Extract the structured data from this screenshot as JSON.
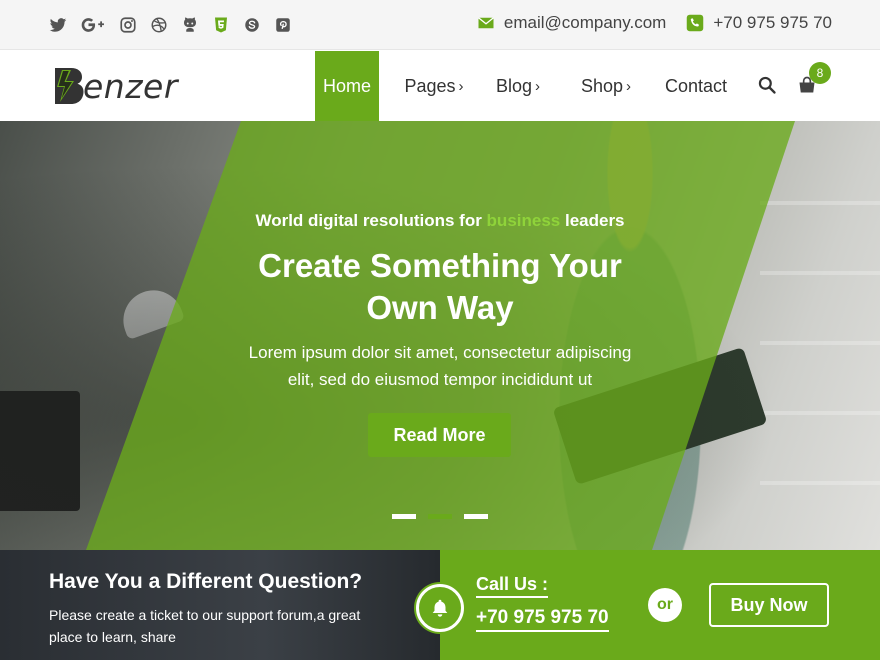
{
  "topbar": {
    "socials": [
      {
        "icon": "twitter-icon"
      },
      {
        "icon": "google-plus-icon"
      },
      {
        "icon": "instagram-icon"
      },
      {
        "icon": "dribbble-icon"
      },
      {
        "icon": "github-icon"
      },
      {
        "icon": "html5-icon"
      },
      {
        "icon": "skype-icon"
      },
      {
        "icon": "pinterest-icon"
      }
    ],
    "email": "email@company.com",
    "phone": "+70 975 975 70"
  },
  "brand": {
    "logo_text": "enzer",
    "accent_color": "#6aaa1b"
  },
  "nav": {
    "items": [
      {
        "label": "Home",
        "active": true
      },
      {
        "label": "Pages",
        "arrow": "›"
      },
      {
        "label": "Blog",
        "arrow": "›"
      },
      {
        "label": "Shop",
        "arrow": "›"
      },
      {
        "label": "Contact"
      }
    ],
    "cart_count": "8"
  },
  "hero": {
    "tagline_pre": "World digital resolutions for ",
    "tagline_highlight": "business",
    "tagline_post": " leaders",
    "headline_line1": "Create Something Your",
    "headline_line2": "Own Way",
    "lead_line1": "Lorem ipsum dolor sit amet, consectetur adipiscing",
    "lead_line2": "elit, sed do eiusmod tempor incididunt ut",
    "cta_label": "Read More",
    "active_slide": 2
  },
  "support": {
    "title": "Have You a Different Question?",
    "text": "Please create a ticket to our support forum,a great place to learn, share",
    "call_label": "Call Us :",
    "call_number": "+70 975 975 70",
    "or_label": "or",
    "buy_label": "Buy Now"
  }
}
